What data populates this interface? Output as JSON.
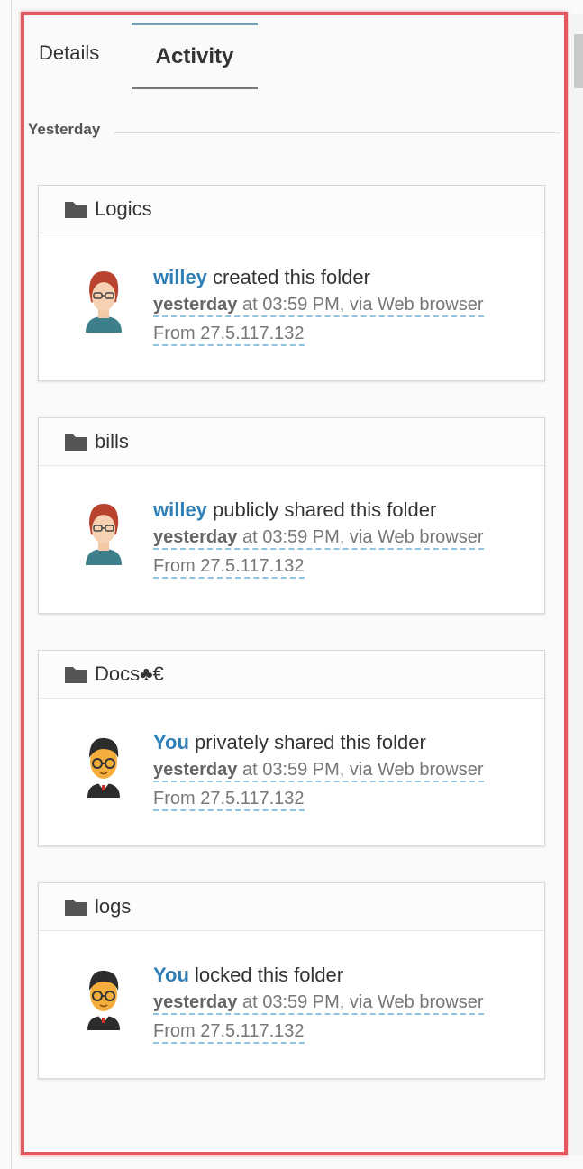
{
  "tabs": {
    "details": "Details",
    "activity": "Activity"
  },
  "section": {
    "label": "Yesterday"
  },
  "activities": [
    {
      "folder": "Logics",
      "user": "willey",
      "action": " created this folder",
      "when_strong": "yesterday",
      "when_rest": " at 03:59 PM, via Web browser",
      "ip": "From 27.5.117.132",
      "avatar": "female-avatar-icon"
    },
    {
      "folder": "bills",
      "user": "willey",
      "action": " publicly shared this folder",
      "when_strong": "yesterday",
      "when_rest": " at 03:59 PM, via Web browser",
      "ip": "From 27.5.117.132",
      "avatar": "female-avatar-icon"
    },
    {
      "folder": "Docs♣€",
      "user": "You",
      "action": " privately shared this folder",
      "when_strong": "yesterday",
      "when_rest": " at 03:59 PM, via Web browser",
      "ip": "From 27.5.117.132",
      "avatar": "male-avatar-icon"
    },
    {
      "folder": "logs",
      "user": "You",
      "action": " locked this folder",
      "when_strong": "yesterday",
      "when_rest": " at 03:59 PM, via Web browser",
      "ip": "From 27.5.117.132",
      "avatar": "male-avatar-icon"
    }
  ],
  "colors": {
    "user_link": "#2f7fb7",
    "highlight": "#e4595f",
    "folder_icon": "#555555"
  }
}
